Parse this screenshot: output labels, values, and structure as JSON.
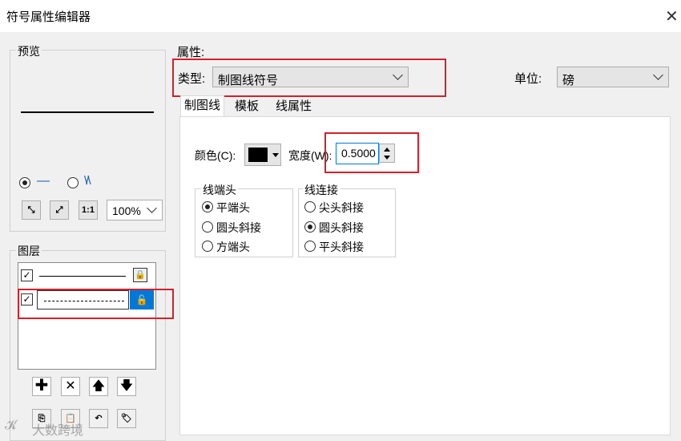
{
  "window": {
    "title": "符号属性编辑器",
    "close_label": "✕"
  },
  "preview": {
    "group_label": "预览",
    "mode_line_label": "—",
    "mode_wave_label": "\\/\\",
    "zoom_value": "100%"
  },
  "layers": {
    "group_label": "图层",
    "items": [
      {
        "checked": true,
        "style": "solid",
        "selected": false
      },
      {
        "checked": true,
        "style": "dashed",
        "selected": true
      }
    ]
  },
  "properties": {
    "group_label": "属性:",
    "type_label": "类型:",
    "type_value": "制图线符号",
    "unit_label": "单位:",
    "unit_value": "磅",
    "tabs": [
      "制图线",
      "模板",
      "线属性"
    ],
    "active_tab": 0,
    "color_label": "颜色(C):",
    "width_label": "宽度(W):",
    "width_value": "0.5000",
    "color_value": "#000000",
    "cap": {
      "group_label": "线端头",
      "options": [
        "平端头",
        "圆头斜接",
        "方端头"
      ],
      "selected": 0
    },
    "join": {
      "group_label": "线连接",
      "options": [
        "尖头斜接",
        "圆头斜接",
        "平头斜接"
      ],
      "selected": 1
    }
  },
  "watermark": "大数跨境",
  "annotation_color": "#d4202a"
}
